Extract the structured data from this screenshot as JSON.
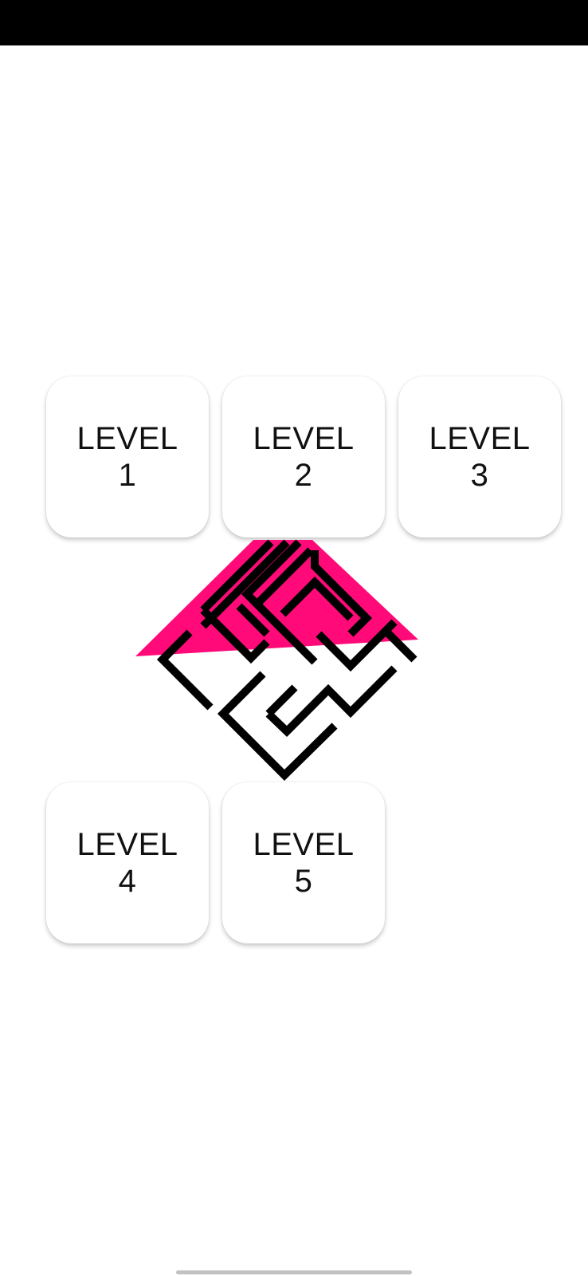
{
  "levels": [
    {
      "title": "LEVEL",
      "number": "1"
    },
    {
      "title": "LEVEL",
      "number": "2"
    },
    {
      "title": "LEVEL",
      "number": "3"
    },
    {
      "title": "LEVEL",
      "number": "4"
    },
    {
      "title": "LEVEL",
      "number": "5"
    }
  ],
  "logo": {
    "icon": "maze-logo-icon",
    "accent_color": "#FF0A78",
    "line_color": "#000000"
  },
  "colors": {
    "status_bar": "#000000",
    "background": "#FFFFFF",
    "home_indicator": "#C2C2C2"
  }
}
